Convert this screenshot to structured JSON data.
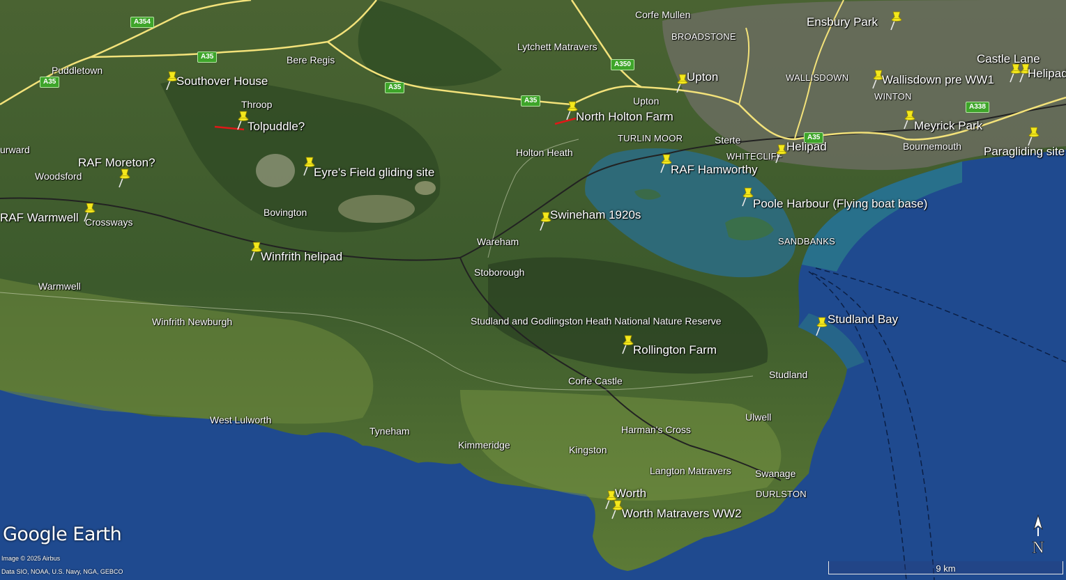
{
  "place_labels": [
    {
      "text": "Corfe Mullen",
      "caps": false
    },
    {
      "text": "BROADSTONE",
      "caps": true
    },
    {
      "text": "Puddletown",
      "caps": false
    },
    {
      "text": "Bere Regis",
      "caps": false
    },
    {
      "text": "Lytchett Matravers",
      "caps": false
    },
    {
      "text": "Throop",
      "caps": false
    },
    {
      "text": "Upton",
      "caps": false
    },
    {
      "text": "WALLISDOWN",
      "caps": true
    },
    {
      "text": "WINTON",
      "caps": true
    },
    {
      "text": "TURLIN MOOR",
      "caps": true
    },
    {
      "text": "Sterte",
      "caps": false
    },
    {
      "text": "WHITECLIFF",
      "caps": true
    },
    {
      "text": "Bournemouth",
      "caps": false
    },
    {
      "text": "urward",
      "caps": false
    },
    {
      "text": "Holton Heath",
      "caps": false
    },
    {
      "text": "Woodsford",
      "caps": false
    },
    {
      "text": "Crossways",
      "caps": false
    },
    {
      "text": "Bovington",
      "caps": false
    },
    {
      "text": "SANDBANKS",
      "caps": true
    },
    {
      "text": "Wareham",
      "caps": false
    },
    {
      "text": "Stoborough",
      "caps": false
    },
    {
      "text": "Warmwell",
      "caps": false
    },
    {
      "text": "Studland and Godlingston Heath National Nature Reserve",
      "caps": false
    },
    {
      "text": "Winfrith Newburgh",
      "caps": false
    },
    {
      "text": "Studland",
      "caps": false
    },
    {
      "text": "Corfe Castle",
      "caps": false
    },
    {
      "text": "West Lulworth",
      "caps": false
    },
    {
      "text": "Tyneham",
      "caps": false
    },
    {
      "text": "Ulwell",
      "caps": false
    },
    {
      "text": "Harman's Cross",
      "caps": false
    },
    {
      "text": "Kimmeridge",
      "caps": false
    },
    {
      "text": "Kingston",
      "caps": false
    },
    {
      "text": "Langton Matravers",
      "caps": false
    },
    {
      "text": "Swanage",
      "caps": false
    },
    {
      "text": "DURLSTON",
      "caps": true
    }
  ],
  "pins": [
    {
      "label": "Ensbury Park"
    },
    {
      "label": "Southover House"
    },
    {
      "label": "Upton"
    },
    {
      "label": "Wallisdown pre WW1"
    },
    {
      "label": "Castle Lane"
    },
    {
      "label": "Helipad"
    },
    {
      "label": "North Holton Farm"
    },
    {
      "label": "Tolpuddle?"
    },
    {
      "label": "Meyrick Park"
    },
    {
      "label": "Helipad"
    },
    {
      "label": "Paragliding site"
    },
    {
      "label": "RAF Moreton?"
    },
    {
      "label": "Eyre's Field gliding site"
    },
    {
      "label": "RAF Hamworthy"
    },
    {
      "label": "Poole Harbour (Flying boat base)"
    },
    {
      "label": "RAF Warmwell"
    },
    {
      "label": "Swineham 1920s"
    },
    {
      "label": "Winfrith helipad"
    },
    {
      "label": "Studland Bay"
    },
    {
      "label": "Rollington Farm"
    },
    {
      "label": "Worth"
    },
    {
      "label": "Worth Matravers WW2"
    }
  ],
  "road_shields": [
    "A354",
    "A35",
    "A35",
    "A35",
    "A35",
    "A350",
    "A338",
    "A35"
  ],
  "branding": {
    "name": "Google Earth"
  },
  "credits": [
    "Image © 2025 Airbus",
    "Data SIO, NOAA, U.S. Navy, NGA, GEBCO"
  ],
  "scale": {
    "label": "9 km"
  },
  "compass": {
    "label": "N"
  },
  "colors": {
    "sea": "#1f4a8f",
    "land": "#3f5a2e",
    "road": "#f3e27a",
    "pin": "#f4e81c"
  }
}
